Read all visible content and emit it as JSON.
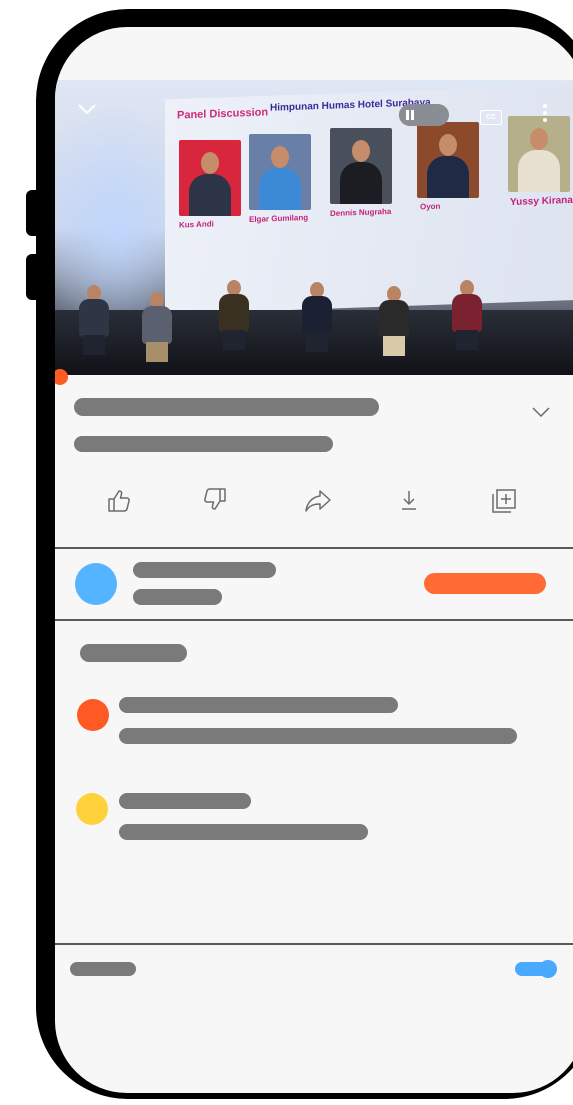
{
  "colors": {
    "frame": "#000000",
    "screen_bg": "#f7f7f7",
    "skeleton": "#7a7a7a",
    "accent_orange": "#ff5a24",
    "subscribe_orange": "#ff6a35",
    "avatar_blue": "#55b4ff",
    "avatar_yellow": "#ffd23c",
    "toggle_blue": "#4aa8ff"
  },
  "video": {
    "panel_title": "Panel Discussion",
    "org_title": "Himpunan Humas Hotel Surabaya",
    "cc_label": "CC",
    "panelists": [
      {
        "name": "Kus Andi",
        "photo_bg": "#d7263d"
      },
      {
        "name": "Elgar Gumilang",
        "photo_bg": "#6a7fa8"
      },
      {
        "name": "Dennis Nugraha",
        "photo_bg": "#4a4f5c"
      },
      {
        "name": "Oyon",
        "photo_bg": "#8b4a2b"
      },
      {
        "name": "Yussy Kirana",
        "photo_bg": "#b6b08a"
      }
    ],
    "icons": {
      "collapse": "chevron-down-icon",
      "pause": "pause-icon",
      "captions": "cc-icon",
      "more": "more-vertical-icon",
      "fullscreen": "fullscreen-icon"
    }
  },
  "actions": [
    {
      "name": "like-button",
      "icon": "thumbs-up-icon",
      "glyph": "👍"
    },
    {
      "name": "dislike-button",
      "icon": "thumbs-down-icon",
      "glyph": "👎"
    },
    {
      "name": "share-button",
      "icon": "share-icon",
      "glyph": "➦"
    },
    {
      "name": "download-button",
      "icon": "download-icon",
      "glyph": "⤓"
    },
    {
      "name": "save-to-playlist-button",
      "icon": "add-to-playlist-icon",
      "glyph": "⊞"
    }
  ]
}
